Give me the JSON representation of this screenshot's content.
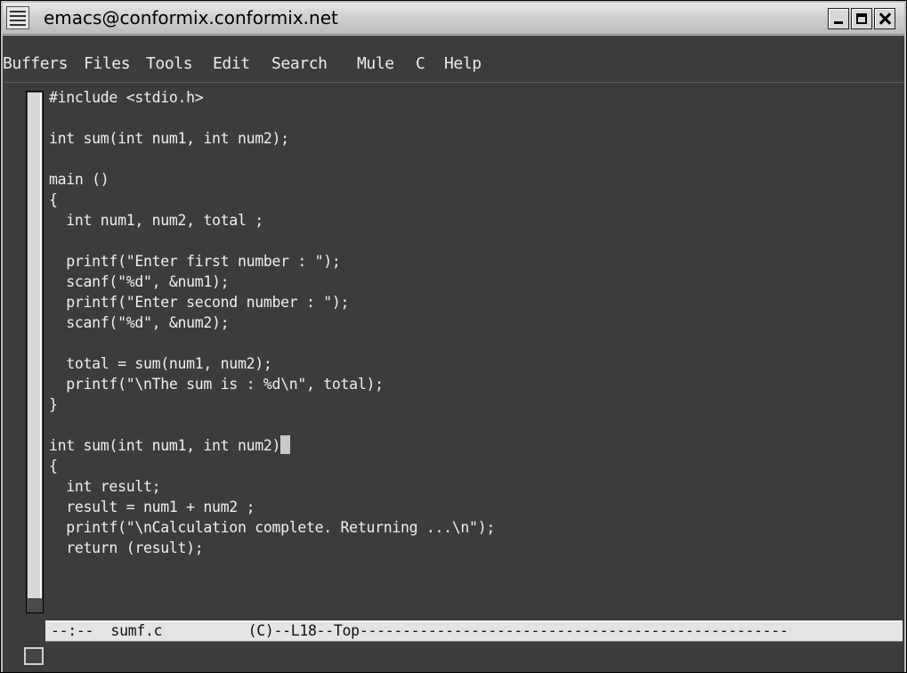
{
  "window": {
    "title": "emacs@conformix.conformix.net"
  },
  "menubar": {
    "items": [
      "Buffers",
      "Files",
      "Tools",
      "Edit",
      "Search",
      "Mule",
      "C",
      "Help"
    ]
  },
  "buffer": {
    "lines": [
      "#include <stdio.h>",
      "",
      "int sum(int num1, int num2);",
      "",
      "main ()",
      "{",
      "  int num1, num2, total ;",
      "",
      "  printf(\"Enter first number : \");",
      "  scanf(\"%d\", &num1);",
      "  printf(\"Enter second number : \");",
      "  scanf(\"%d\", &num2);",
      "",
      "  total = sum(num1, num2);",
      "  printf(\"\\nThe sum is : %d\\n\", total);",
      "}",
      "",
      "int sum(int num1, int num2)",
      "{",
      "  int result;",
      "  result = num1 + num2 ;",
      "  printf(\"\\nCalculation complete. Returning ...\\n\");",
      "  return (result);"
    ],
    "cursor_line": 18
  },
  "modeline": {
    "text": "--:--  sumf.c          (C)--L18--Top--------------------------------------------------"
  },
  "colors": {
    "background": "#3c3c3c",
    "foreground": "#f0f0f0",
    "modeline_bg": "#e4e4e4"
  }
}
